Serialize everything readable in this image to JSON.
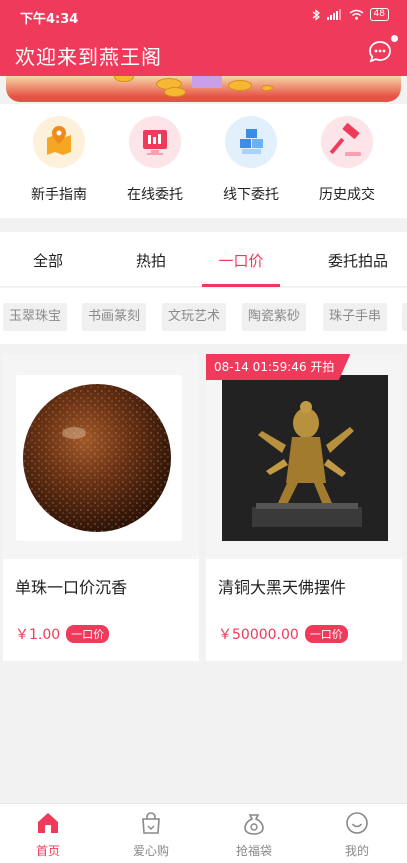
{
  "status_bar": {
    "time": "下午4:34",
    "battery": "48"
  },
  "header": {
    "title": "欢迎来到燕王阁"
  },
  "quick_menu": [
    {
      "label": "新手指南",
      "icon": "map-pin-icon",
      "color": "#f5a623"
    },
    {
      "label": "在线委托",
      "icon": "monitor-icon",
      "color": "#f03a5b"
    },
    {
      "label": "线下委托",
      "icon": "blocks-icon",
      "color": "#3a8ee6"
    },
    {
      "label": "历史成交",
      "icon": "gavel-icon",
      "color": "#f03a5b"
    }
  ],
  "tabs": [
    {
      "label": "全部"
    },
    {
      "label": "热拍"
    },
    {
      "label": "一口价",
      "active": true
    },
    {
      "label": "委托拍品"
    }
  ],
  "categories": [
    "玉翠珠宝",
    "书画篆刻",
    "文玩艺术",
    "陶瓷紫砂",
    "珠子手串"
  ],
  "products": [
    {
      "name": "单珠一口价沉香",
      "price": "￥1.00",
      "badge": "一口价"
    },
    {
      "name": "清铜大黑天佛摆件",
      "price": "￥50000.00",
      "badge": "一口价",
      "countdown": "08-14 01:59:46 开拍"
    }
  ],
  "bottom_nav": [
    {
      "label": "首页",
      "icon": "home-icon",
      "active": true
    },
    {
      "label": "爱心购",
      "icon": "shopping-bag-icon"
    },
    {
      "label": "抢福袋",
      "icon": "lucky-bag-icon"
    },
    {
      "label": "我的",
      "icon": "smile-face-icon"
    }
  ],
  "colors": {
    "brand": "#f03a5b",
    "background": "#f2f2f2"
  }
}
